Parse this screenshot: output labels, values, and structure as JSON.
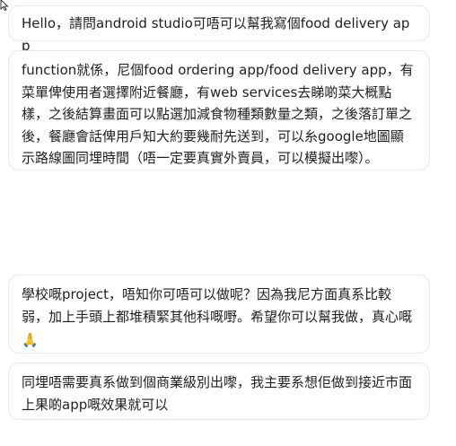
{
  "messages": [
    {
      "text": "Hello，請問android studio可唔可以幫我寫個food delivery app"
    },
    {
      "text": "function就係，尼個food ordering app/food delivery app，有菜單俾使用者選擇附近餐廳，有web services去睇啲菜大概點樣，之後結算畫面可以點選加減食物種類數量之類，之後落訂單之後，餐廳會話俾用戶知大約要幾耐先送到，可以糸google地圖顯示路線圖同埋時間（唔一定要真實外賣員，可以模擬出嚟）。"
    },
    {
      "text": "學校嘅project，唔知你可唔可以做呢？因為我尼方面真系比較弱，加上手頭上都堆積緊其他科嘅嘢。希望你可以幫我做，真心嘅",
      "emoji": "🙏"
    },
    {
      "text": "同埋唔需要真系做到個商業級別出嚟，我主要系想佢做到接近市面上果啲app嘅效果就可以"
    }
  ],
  "icons": {
    "cursor": "mouse-pointer-icon",
    "emoji": "folded-hands-emoji"
  },
  "colors": {
    "background": "#ffffff",
    "bubble_border": "#e9e9ee",
    "text": "#1f1f1f"
  }
}
